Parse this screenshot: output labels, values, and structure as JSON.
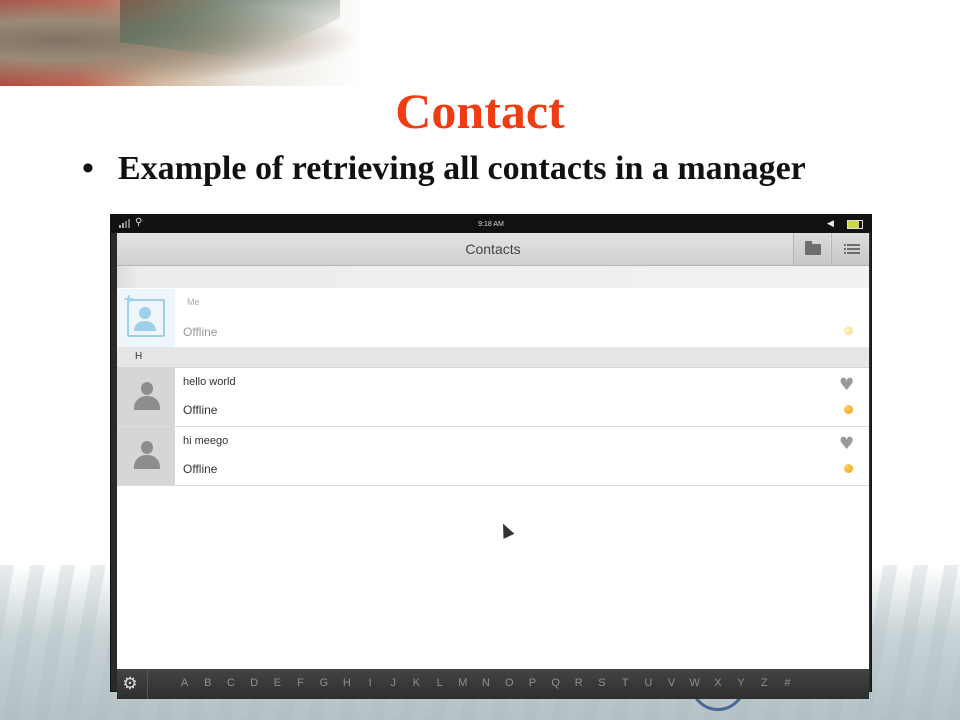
{
  "slide": {
    "title": "Contact",
    "bullet": "Example of retrieving all contacts in a manager"
  },
  "device": {
    "status_time": "9:18 AM",
    "app_title": "Contacts",
    "me": {
      "name": "Me",
      "status": "Offline"
    },
    "section_header": "H",
    "contacts": [
      {
        "name": "hello  world",
        "status": "Offline",
        "favorite": true
      },
      {
        "name": "hi  meego",
        "status": "Offline",
        "favorite": true
      }
    ],
    "alphabet": [
      "A",
      "B",
      "C",
      "D",
      "E",
      "F",
      "G",
      "H",
      "I",
      "J",
      "K",
      "L",
      "M",
      "N",
      "O",
      "P",
      "Q",
      "R",
      "S",
      "T",
      "U",
      "V",
      "W",
      "X",
      "Y",
      "Z",
      "#"
    ],
    "icons": {
      "folder": "folder-icon",
      "menu": "menu-list-icon",
      "settings": "gear-icon",
      "favorite": "heart-icon",
      "presence": "presence-dot-icon"
    }
  },
  "colors": {
    "title": "#f03c12",
    "presence_offline": "#f09a00"
  }
}
